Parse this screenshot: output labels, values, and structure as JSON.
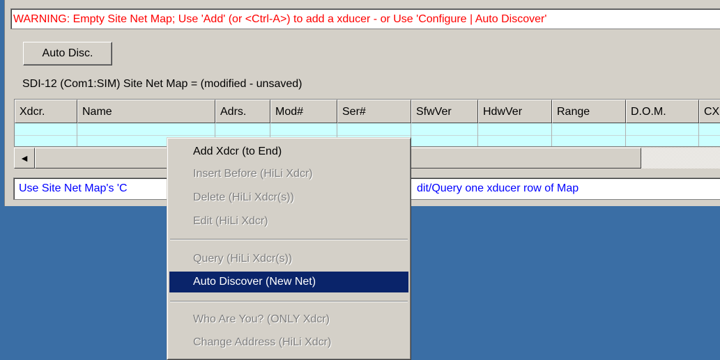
{
  "warning": "WARNING: Empty Site Net Map; Use 'Add' (or <Ctrl-A>) to add a xducer - or Use 'Configure | Auto Discover'",
  "toolbar": {
    "auto_disc_label": "Auto Disc."
  },
  "caption": "SDI-12 (Com1:SIM) Site Net Map = (modified - unsaved)",
  "grid": {
    "columns": [
      "Xdcr.",
      "Name",
      "Adrs.",
      "Mod#",
      "Ser#",
      "SfwVer",
      "HdwVer",
      "Range",
      "D.O.M.",
      "CX"
    ],
    "row_color": "#ccffff"
  },
  "scrollbar": {
    "left_arrow": "◄"
  },
  "status": {
    "text_left": "Use Site Net Map's 'C",
    "text_right": "dit/Query one xducer row of Map"
  },
  "context_menu": {
    "items": [
      {
        "label": "Add Xdcr (to End)",
        "enabled": true
      },
      {
        "label": "Insert Before (HiLi Xdcr)",
        "enabled": false
      },
      {
        "label": "Delete (HiLi Xdcr(s))",
        "enabled": false
      },
      {
        "label": "Edit (HiLi Xdcr)",
        "enabled": false
      },
      {
        "label": "Query (HiLi Xdcr(s))",
        "enabled": false
      },
      {
        "label": "Auto Discover (New Net)",
        "enabled": true,
        "highlighted": true
      },
      {
        "label": "Who Are You?  (ONLY Xdcr)",
        "enabled": false
      },
      {
        "label": "Change Address (HiLi Xdcr)",
        "enabled": false
      }
    ]
  },
  "colors": {
    "desktop": "#3a6ea5",
    "warning_text": "#ff0000",
    "status_text": "#0000ff",
    "menu_highlight": "#0a246a"
  }
}
